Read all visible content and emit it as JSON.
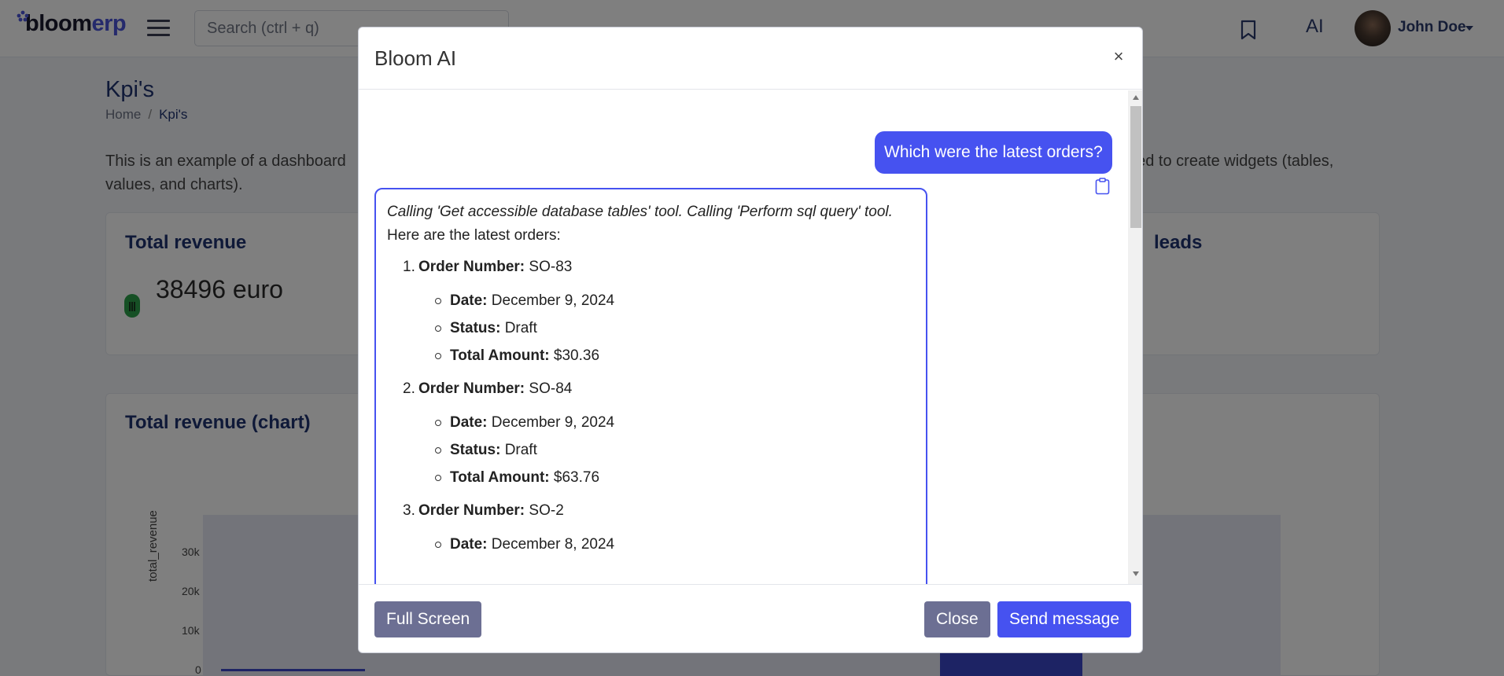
{
  "app": {
    "logo_part1": "bloom",
    "logo_part2": "erp",
    "search_placeholder": "Search (ctrl + q)",
    "ai_link": "AI",
    "user_name": "John Doe"
  },
  "page": {
    "title": "Kpi's",
    "breadcrumb": [
      "Home",
      "Kpi's"
    ],
    "intro_visible": "This is an example of a dashboard",
    "intro_tail_line1": "used to create widgets (tables,",
    "intro_line2": "values, and charts)."
  },
  "cards": {
    "revenue_title": "Total revenue",
    "revenue_value": "38496 euro",
    "leads_title_fragment": "leads",
    "chart_title": "Total revenue (chart)"
  },
  "chart_data": {
    "type": "bar",
    "ylabel": "total_revenue",
    "yticks": [
      "30k",
      "20k",
      "10k",
      "0"
    ],
    "ylim": [
      0,
      40000
    ]
  },
  "modal": {
    "title": "Bloom AI",
    "close_glyph": "×",
    "user_message": "Which were the latest orders?",
    "tool_calls": "Calling 'Get accessible database tables' tool. Calling 'Perform sql query' tool.",
    "intro": "Here are the latest orders:",
    "orders": [
      {
        "index": "1.",
        "label": "Order Number:",
        "number": "SO-83",
        "date_label": "Date:",
        "date": "December 9, 2024",
        "status_label": "Status:",
        "status": "Draft",
        "amount_label": "Total Amount:",
        "amount": "$30.36"
      },
      {
        "index": "2.",
        "label": "Order Number:",
        "number": "SO-84",
        "date_label": "Date:",
        "date": "December 9, 2024",
        "status_label": "Status:",
        "status": "Draft",
        "amount_label": "Total Amount:",
        "amount": "$63.76"
      },
      {
        "index": "3.",
        "label": "Order Number:",
        "number": "SO-2",
        "date_label": "Date:",
        "date": "December 8, 2024"
      }
    ],
    "buttons": {
      "full_screen": "Full Screen",
      "close": "Close",
      "send": "Send message"
    }
  },
  "colors": {
    "primary": "#4652f0",
    "secondary": "#6c6f93",
    "heading": "#1f3370"
  }
}
